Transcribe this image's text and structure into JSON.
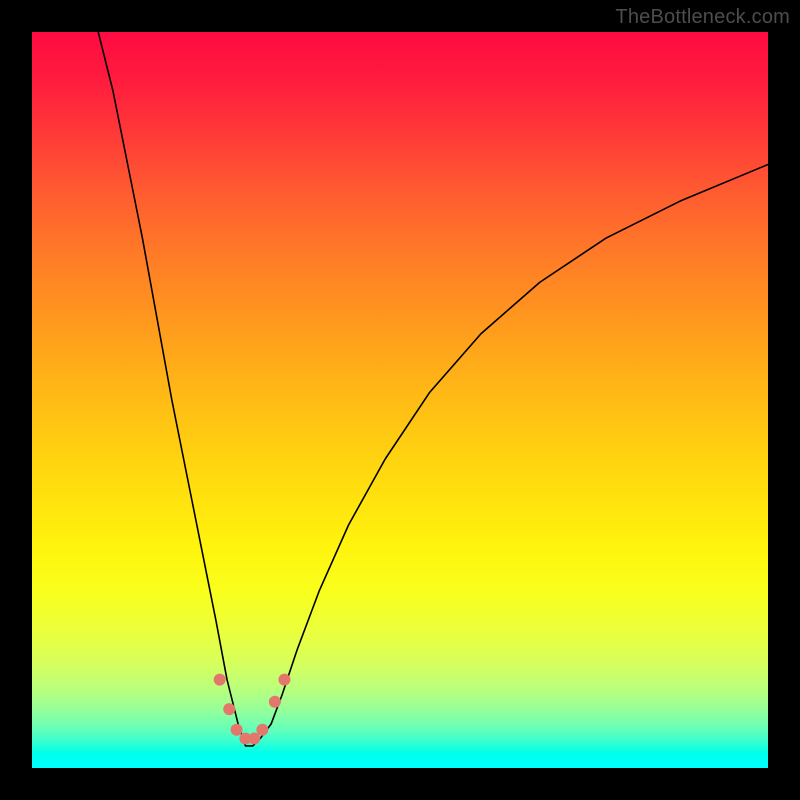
{
  "watermark": "TheBottleneck.com",
  "colors": {
    "background": "#000000",
    "curve_stroke": "#000000",
    "dot_fill": "#e4776b",
    "watermark_text": "#4d4d4d"
  },
  "chart_data": {
    "type": "line",
    "title": "",
    "xlabel": "",
    "ylabel": "",
    "xlim": [
      0,
      100
    ],
    "ylim": [
      0,
      100
    ],
    "grid": false,
    "legend": false,
    "notes": "Vertical axis visually encodes bottleneck severity via a rainbow heat gradient (red near 100, green/cyan near 0). No axis ticks or labels are drawn. Curve minimum is around x≈29, y≈3.",
    "series": [
      {
        "name": "bottleneck-curve",
        "points": [
          {
            "x": 9,
            "y": 100
          },
          {
            "x": 11,
            "y": 92
          },
          {
            "x": 13,
            "y": 82
          },
          {
            "x": 15,
            "y": 72
          },
          {
            "x": 17,
            "y": 61
          },
          {
            "x": 19,
            "y": 50
          },
          {
            "x": 21,
            "y": 40
          },
          {
            "x": 23,
            "y": 30
          },
          {
            "x": 25,
            "y": 20
          },
          {
            "x": 26.5,
            "y": 12
          },
          {
            "x": 28,
            "y": 6
          },
          {
            "x": 29,
            "y": 3
          },
          {
            "x": 30,
            "y": 3
          },
          {
            "x": 31,
            "y": 4
          },
          {
            "x": 32.5,
            "y": 6
          },
          {
            "x": 34,
            "y": 10
          },
          {
            "x": 36,
            "y": 16
          },
          {
            "x": 39,
            "y": 24
          },
          {
            "x": 43,
            "y": 33
          },
          {
            "x": 48,
            "y": 42
          },
          {
            "x": 54,
            "y": 51
          },
          {
            "x": 61,
            "y": 59
          },
          {
            "x": 69,
            "y": 66
          },
          {
            "x": 78,
            "y": 72
          },
          {
            "x": 88,
            "y": 77
          },
          {
            "x": 100,
            "y": 82
          }
        ]
      }
    ],
    "dots": [
      {
        "x": 25.5,
        "y": 12
      },
      {
        "x": 26.8,
        "y": 8
      },
      {
        "x": 27.8,
        "y": 5.2
      },
      {
        "x": 29.0,
        "y": 4.0
      },
      {
        "x": 30.2,
        "y": 4.0
      },
      {
        "x": 31.3,
        "y": 5.2
      },
      {
        "x": 33.0,
        "y": 9
      },
      {
        "x": 34.3,
        "y": 12
      }
    ]
  }
}
